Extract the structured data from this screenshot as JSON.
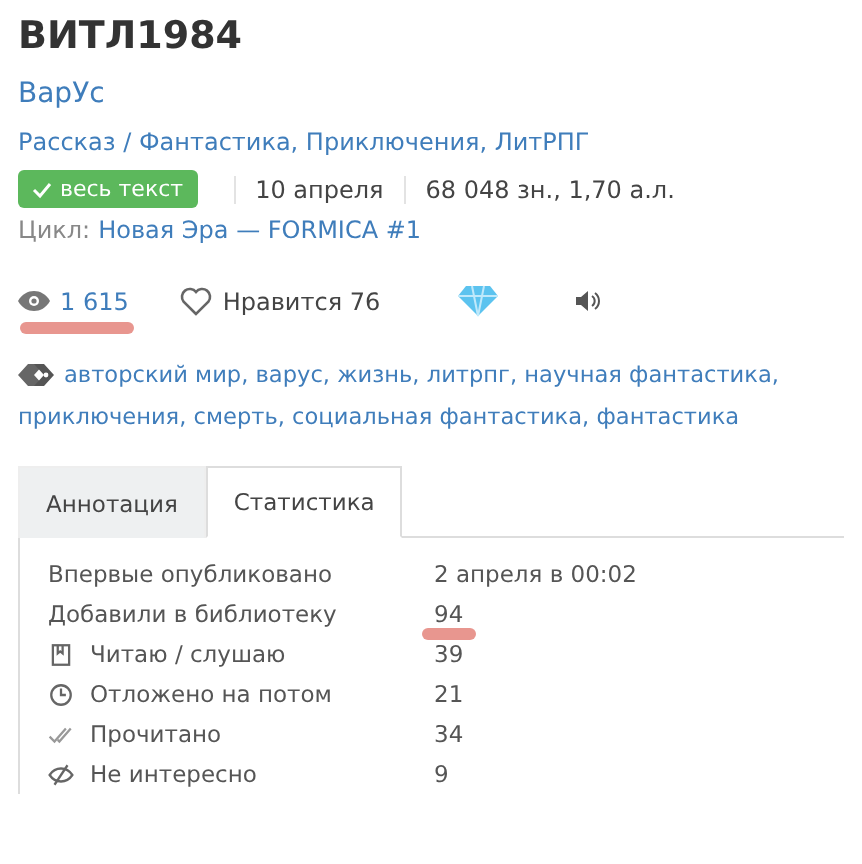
{
  "title": "ВИТЛ1984",
  "author": "ВарУс",
  "genre": "Рассказ / Фантастика, Приключения, ЛитРПГ",
  "meta": {
    "badge": "весь текст",
    "date": "10 апреля",
    "size": "68 048 зн., 1,70 а.л."
  },
  "cycle": {
    "label": "Цикл:",
    "name": "Новая Эра — FORMICA #1"
  },
  "stats": {
    "views": "1 615",
    "views_marked": true,
    "likes": "Нравится 76"
  },
  "tags": "авторский мир, варус, жизнь, литрпг, научная фантастика, приключения, смерть, социальная фантастика, фантастика",
  "tabs": [
    {
      "label": "Аннотация",
      "selected": false
    },
    {
      "label": "Статистика",
      "selected": true
    }
  ],
  "rows": [
    {
      "kind": "plain",
      "label": "Впервые опубликовано",
      "value": "2 апреля в 00:02",
      "marked": false
    },
    {
      "kind": "plain",
      "label": "Добавили в библиотеку",
      "value": "94",
      "marked": true
    },
    {
      "kind": "reading",
      "label": "Читаю / слушаю",
      "value": "39",
      "marked": false
    },
    {
      "kind": "deferred",
      "label": "Отложено на потом",
      "value": "21",
      "marked": false
    },
    {
      "kind": "finished",
      "label": "Прочитано",
      "value": "34",
      "marked": false
    },
    {
      "kind": "ignored",
      "label": "Не интересно",
      "value": "9",
      "marked": false
    }
  ]
}
